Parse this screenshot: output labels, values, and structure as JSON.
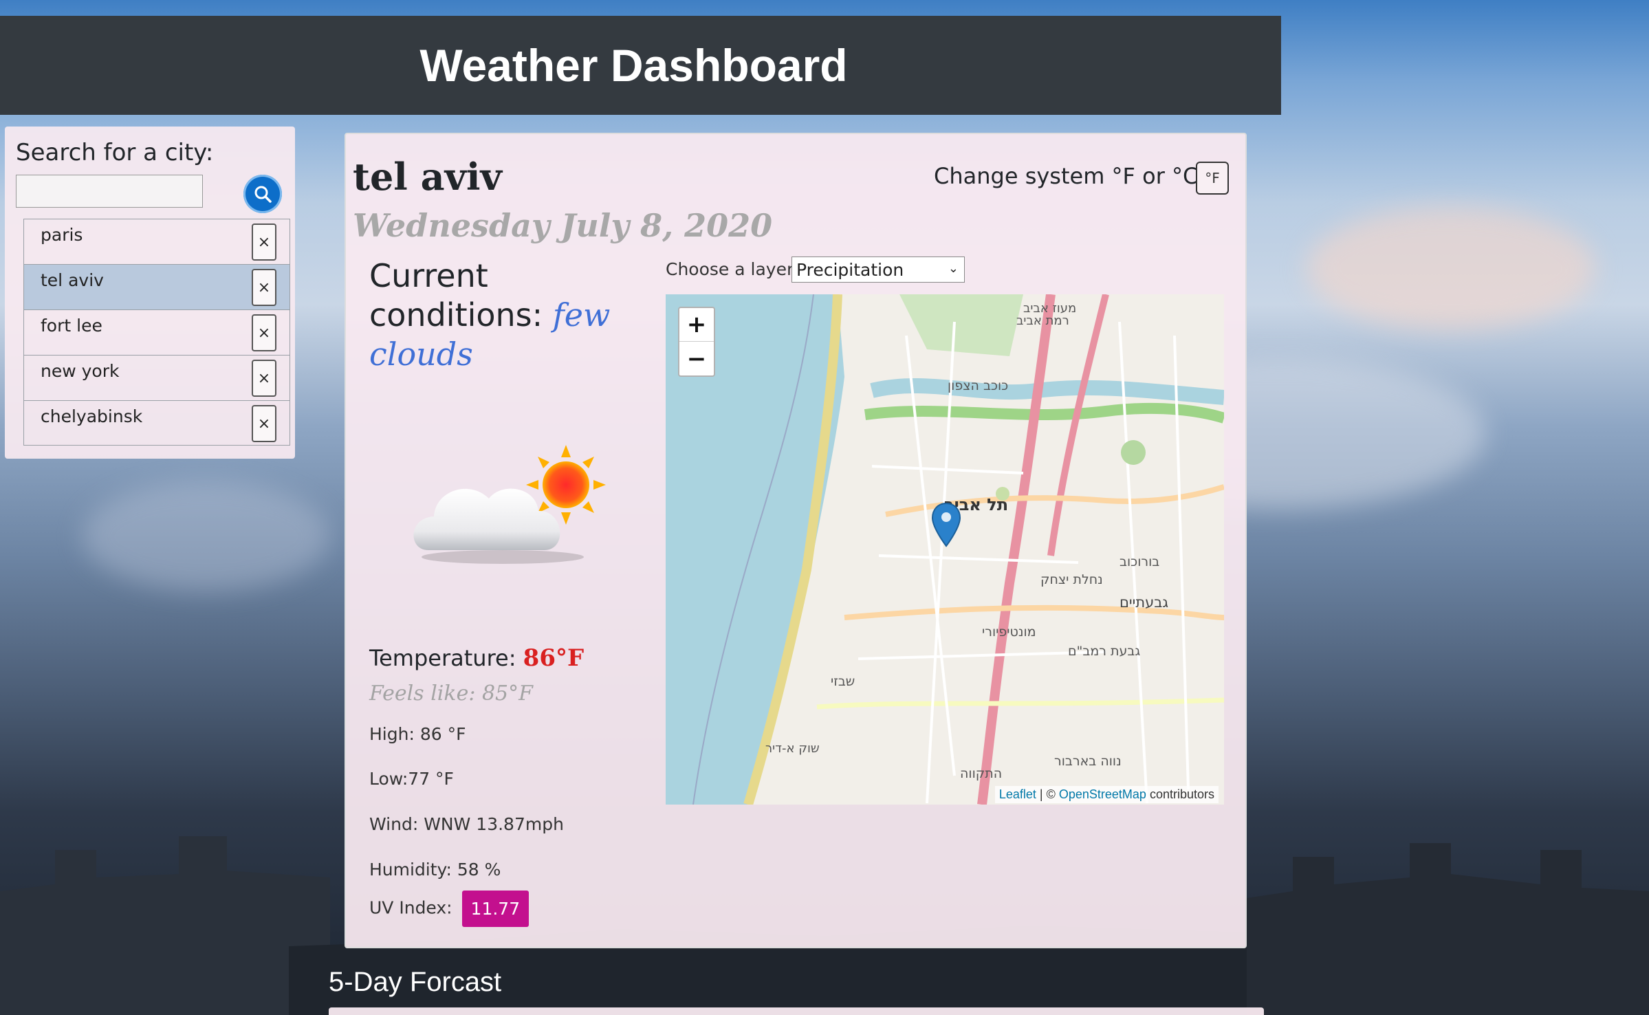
{
  "header": {
    "title": "Weather Dashboard"
  },
  "search": {
    "title": "Search for a city:",
    "placeholder": "",
    "cities": [
      {
        "name": "paris",
        "active": false
      },
      {
        "name": "tel aviv",
        "active": true
      },
      {
        "name": "fort lee",
        "active": false
      },
      {
        "name": "new york",
        "active": false
      },
      {
        "name": "chelyabinsk",
        "active": false
      }
    ],
    "remove_label": "×"
  },
  "current": {
    "city": "tel aviv",
    "date": "Wednesday July 8, 2020",
    "unit_toggle_label": "Change system °F or °C :",
    "unit_button": "°F",
    "conditions_label": "Current conditions:",
    "conditions_value": "few clouds",
    "temperature_label": "Temperature:",
    "temperature_value": "86°F",
    "feels_like": "Feels like: 85°F",
    "high": "High: 86 °F",
    "low": "Low:77 °F",
    "wind": "Wind: WNW 13.87mph",
    "humidity": "Humidity: 58 %",
    "uv_label": "UV Index:",
    "uv_value": "11.77",
    "icon": "few-clouds-day-icon"
  },
  "map": {
    "layer_label": "Choose a layer:",
    "layer_selected": "Precipitation",
    "zoom_in": "+",
    "zoom_out": "−",
    "attribution_leaflet": "Leaflet",
    "attribution_sep": " | © ",
    "attribution_osm": "OpenStreetMap",
    "attribution_tail": " contributors",
    "labels": [
      "מעוז אביב",
      "רמת אביב",
      "כוכב הצפון",
      "תל אביב",
      "נחלת יצחק",
      "בורוכוב",
      "גבעתיים",
      "מונטיפיורי",
      "גבעת רמב\"ם",
      "שבזי",
      "שוק א-דיר",
      "נווה בארבור",
      "התקווה"
    ]
  },
  "forecast": {
    "title": "5-Day Forcast"
  },
  "colors": {
    "header_bg": "#343a40",
    "uv_badge": "#c3108e",
    "temp_value": "#d92020",
    "conditions": "#3f6fd6"
  }
}
